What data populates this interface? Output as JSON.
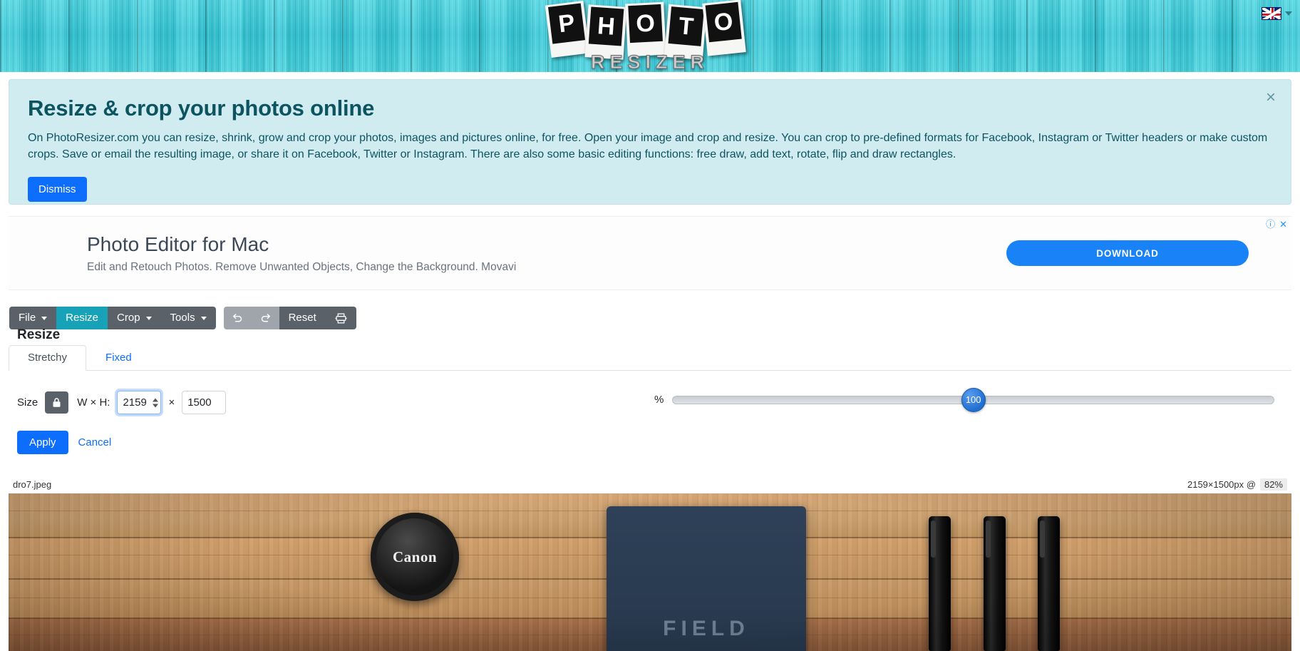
{
  "header": {
    "logo_letters": [
      "P",
      "H",
      "O",
      "T",
      "O"
    ],
    "logo_word": "RESIZER",
    "language_flag": "uk-flag-icon"
  },
  "alert": {
    "title": "Resize & crop your photos online",
    "body": "On PhotoResizer.com you can resize, shrink, grow and crop your photos, images and pictures online, for free. Open your image and crop and resize. You can crop to pre-defined formats for Facebook, Instagram or Twitter headers or make custom crops. Save or email the resulting image, or share it on Facebook, Twitter or Instagram. There are also some basic editing functions: free draw, add text, rotate, flip and draw rectangles.",
    "dismiss_label": "Dismiss",
    "close_label": "×",
    "bg_color": "#d1ecf1",
    "text_color": "#0c5460"
  },
  "ad": {
    "title": "Photo Editor for Mac",
    "subtitle": "Edit and Retouch Photos. Remove Unwanted Objects, Change the Background. Movavi",
    "cta_label": "DOWNLOAD",
    "cta_color": "#1a82f7",
    "info_mark": "ⓘ",
    "close_mark": "✕"
  },
  "toolbar": {
    "menus": [
      {
        "label": "File",
        "caret": true,
        "active": false
      },
      {
        "label": "Resize",
        "caret": false,
        "active": true
      },
      {
        "label": "Crop",
        "caret": true,
        "active": false
      },
      {
        "label": "Tools",
        "caret": true,
        "active": false
      }
    ],
    "history": [
      {
        "name": "undo-icon",
        "label": ""
      },
      {
        "name": "redo-icon",
        "label": ""
      },
      {
        "name": "reset-button",
        "label": "Reset"
      },
      {
        "name": "print-icon",
        "label": ""
      }
    ],
    "active_color": "#17a2b8",
    "base_color": "#5a6169"
  },
  "panel": {
    "title": "Resize",
    "tabs": [
      {
        "label": "Stretchy",
        "active": true
      },
      {
        "label": "Fixed",
        "active": false
      }
    ],
    "size_label": "Size",
    "lock_icon": "lock-icon",
    "wh_label": "W × H:",
    "width_value": "2159",
    "multiply_symbol": "×",
    "height_value": "1500",
    "percent_label": "%",
    "percent_value": "100",
    "percent_min": 0,
    "percent_max": 200,
    "apply_label": "Apply",
    "cancel_label": "Cancel"
  },
  "status": {
    "filename": "dro7.jpeg",
    "dimensions": "2159×1500px @",
    "zoom": "82%"
  },
  "photo": {
    "lens_cap_brand": "Canon",
    "notebook_text": "FIELD"
  }
}
